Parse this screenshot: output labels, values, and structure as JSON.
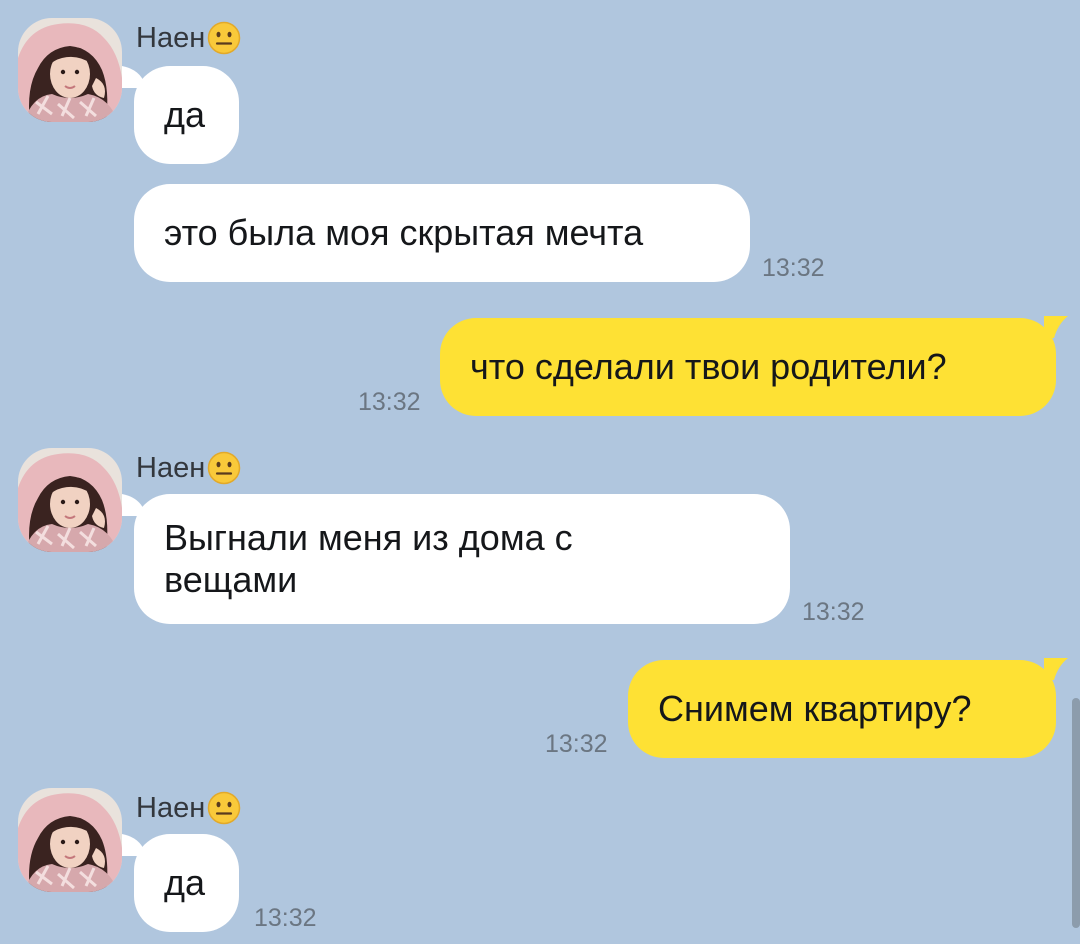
{
  "chat": {
    "sender_name": "Наен",
    "sender_emoji": "neutral-face-emoji",
    "colors": {
      "background": "#b0c6de",
      "incoming_bubble": "#ffffff",
      "outgoing_bubble": "#fee134",
      "timestamp": "#6b7682"
    },
    "messages": [
      {
        "direction": "incoming",
        "text": "да",
        "time": ""
      },
      {
        "direction": "incoming",
        "text": "это была моя скрытая мечта",
        "time": "13:32"
      },
      {
        "direction": "outgoing",
        "text": "что сделали твои родители?",
        "time": "13:32"
      },
      {
        "direction": "incoming",
        "text": "Выгнали меня из дома с вещами",
        "time": "13:32"
      },
      {
        "direction": "outgoing",
        "text": "Снимем квартиру?",
        "time": "13:32"
      },
      {
        "direction": "incoming",
        "text": "да",
        "time": "13:32"
      }
    ]
  }
}
